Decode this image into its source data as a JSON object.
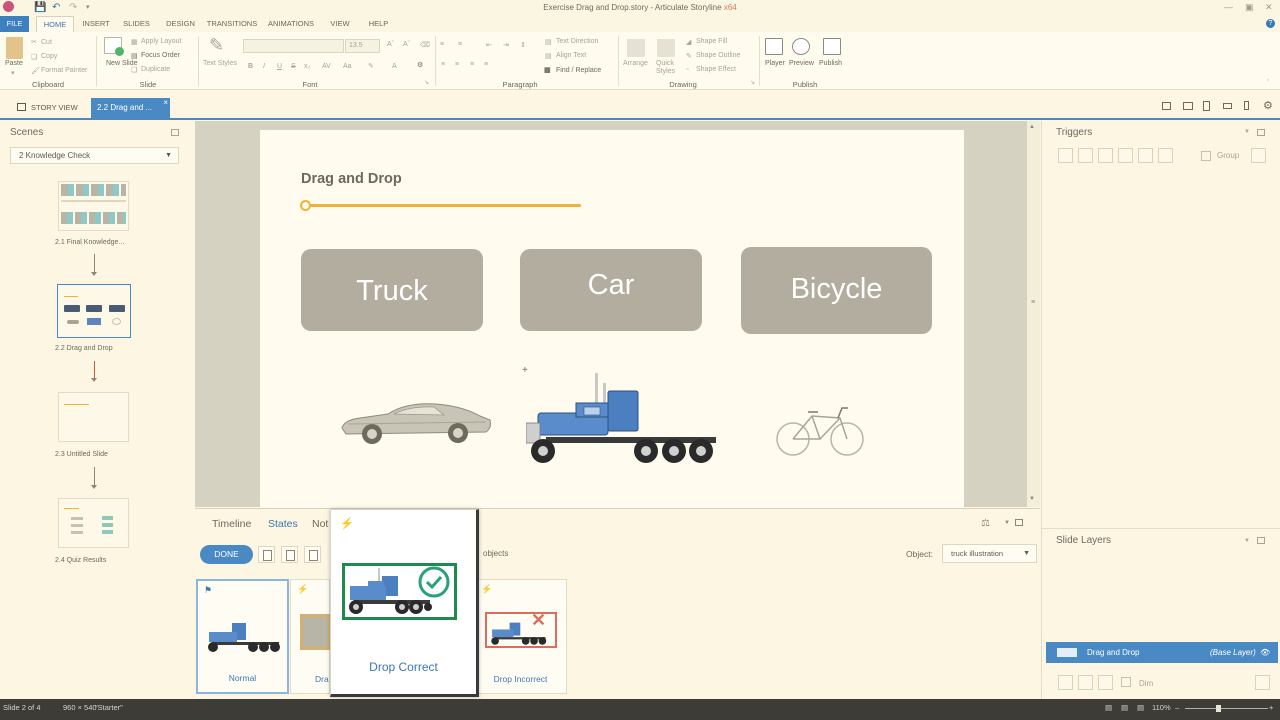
{
  "app": {
    "title": "Exercise Drag and Drop.story - Articulate Storyline",
    "title_suffix": "x64"
  },
  "menu": {
    "file": "FILE",
    "tabs": [
      "HOME",
      "INSERT",
      "SLIDES",
      "DESIGN",
      "TRANSITIONS",
      "ANIMATIONS",
      "VIEW",
      "HELP"
    ],
    "active": "HOME"
  },
  "ribbon": {
    "clipboard": {
      "label": "Clipboard",
      "paste": "Paste",
      "cut": "Cut",
      "copy": "Copy",
      "format_painter": "Format Painter"
    },
    "slide": {
      "label": "Slide",
      "new_slide": "New Slide",
      "apply_layout": "Apply Layout",
      "focus_order": "Focus Order",
      "duplicate": "Duplicate"
    },
    "font": {
      "label": "Font",
      "text_styles": "Text Styles",
      "font_size": "13.5",
      "bold": "B",
      "italic": "I",
      "underline": "U",
      "strike": "S"
    },
    "paragraph": {
      "label": "Paragraph",
      "text_direction": "Text Direction",
      "align_text": "Align Text",
      "find_replace": "Find / Replace"
    },
    "drawing": {
      "label": "Drawing",
      "arrange": "Arrange",
      "quick_styles": "Quick Styles",
      "shape_fill": "Shape Fill",
      "shape_outline": "Shape Outline",
      "shape_effect": "Shape Effect"
    },
    "publish": {
      "label": "Publish",
      "player": "Player",
      "preview": "Preview",
      "publish": "Publish"
    }
  },
  "tabs": {
    "story_view": "STORY VIEW",
    "current_slide": "2.2 Drag and ..."
  },
  "scenes": {
    "title": "Scenes",
    "dropdown_value": "2 Knowledge Check",
    "slides": [
      {
        "label": "2.1 Final Knowledge..."
      },
      {
        "label": "2.2 Drag and Drop"
      },
      {
        "label": "2.3 Untitled Slide"
      },
      {
        "label": "2.4 Quiz Results"
      }
    ]
  },
  "slide": {
    "heading": "Drag and Drop",
    "targets": [
      "Truck",
      "Car",
      "Bicycle"
    ]
  },
  "bottom_panel": {
    "tabs": [
      "Timeline",
      "States",
      "Not"
    ],
    "done": "DONE",
    "objects_text": "objects",
    "object_label": "Object:",
    "object_value": "truck illustration",
    "states": [
      {
        "label": "Normal"
      },
      {
        "label": "Dra"
      },
      {
        "label": "Drop Incorrect"
      }
    ],
    "popup_label": "Drop Correct"
  },
  "triggers": {
    "title": "Triggers",
    "group": "Group"
  },
  "slide_layers": {
    "title": "Slide Layers",
    "layer_name": "Drag and Drop",
    "layer_tag": "(Base Layer)",
    "dim": "Dim"
  },
  "status": {
    "slide_count": "Slide 2 of 4",
    "dimensions": "960 × 540",
    "theme": "\"Starter\"",
    "zoom": "110%"
  },
  "colors": {
    "accent_blue": "#4a8ac4",
    "progress_orange": "#f2b237",
    "target_gray": "#b2ad9f",
    "correct_green": "#1f8a4c",
    "incorrect_red": "#e06b5c"
  }
}
